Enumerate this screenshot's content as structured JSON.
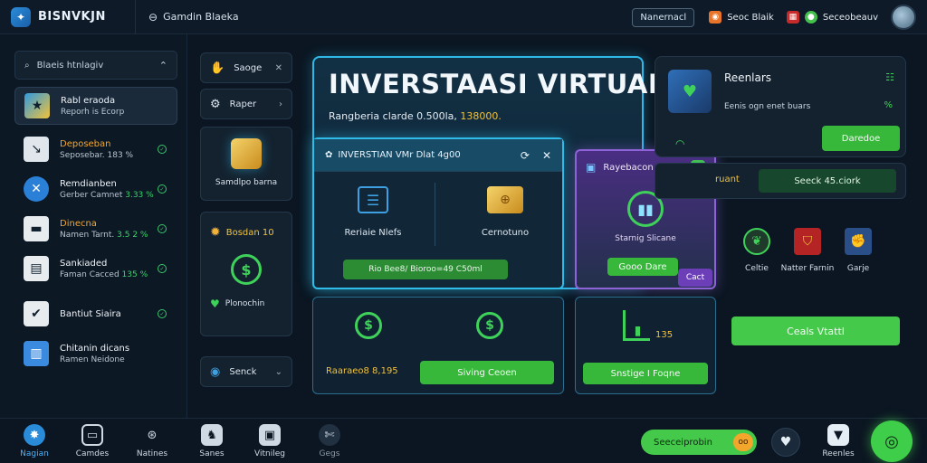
{
  "topbar": {
    "brand": "BISNVKJN",
    "search_label": "Gamdin Blaeka",
    "action_button": "Nanernacl",
    "items": [
      {
        "label": "Seoc Blaik",
        "color": "#e8742a"
      },
      {
        "label": "Seceobeauv",
        "color": "#44c04c"
      }
    ]
  },
  "sidebar": {
    "search_placeholder": "Blaeis htnlagiv",
    "items": [
      {
        "title": "Rabl eraoda",
        "sub": "Reporh is Ecorp",
        "color": "#f2c23a",
        "active": true
      },
      {
        "title": "Deposeban",
        "sub": "Seposebar. 183 %",
        "color": "#e0e6ec",
        "orange": true
      },
      {
        "title": "Remdianben",
        "sub": "Gerber Camnet",
        "sub_pct": "3.33 %",
        "color": "#2a7fd6"
      },
      {
        "title": "Dinecna",
        "sub": "Namen Tarnt.",
        "sub_pct": "3.5 2 %",
        "color": "#e8ecef",
        "orange": true
      },
      {
        "title": "Sankiaded",
        "sub": "Faman Cacced",
        "sub_pct": "135 %",
        "color": "#e8ecef"
      },
      {
        "title": "Bantiut Siaira",
        "sub": "",
        "color": "#e8ecef"
      },
      {
        "title": "Chitanin dicans",
        "sub": "Ramen Neidone",
        "color": "#3a8be0"
      }
    ]
  },
  "col2": {
    "btn1": "Saoge",
    "btn2": "Raper",
    "card1_label": "Samdlpo barna",
    "card2_title": "Bosdan 10",
    "card2_label": "Plonochin",
    "btn3": "Senck"
  },
  "hero": {
    "title": "INVERSTAASI VIRTUAL",
    "sub_prefix": "Rangberia clarde 0.500la,",
    "sub_value": "138000."
  },
  "modal": {
    "title": "INVERSTIAN VMr Dlat 4g00",
    "left_label": "Reriaie Nlefs",
    "right_label": "Cernotuno",
    "bar_label": "Rio Bee8/ Bioroo=49 C50ml"
  },
  "purple": {
    "title": "Rayebacon",
    "label": "Starnig Slicane",
    "button": "Gooo Dare",
    "badge": "Cact"
  },
  "lower": {
    "left_label": "Raaraeo8 8,195",
    "left_button": "Siving Ceoen",
    "right_value": "135",
    "right_button": "Snstige I Foqne"
  },
  "right_panel": {
    "title": "Reenlars",
    "sub": "Eenis ogn enet buars",
    "pct": "%",
    "button": "Daredoe",
    "row_left": "ruant",
    "row_right": "Seeck 45.ciork",
    "icons": [
      {
        "label": "Celtie"
      },
      {
        "label": "Natter Farnin"
      },
      {
        "label": "Garje"
      }
    ],
    "big_button": "Ceals Vtattl"
  },
  "bottombar": {
    "items": [
      {
        "label": "Nagian",
        "active": true
      },
      {
        "label": "Camdes"
      },
      {
        "label": "Natines"
      },
      {
        "label": "Sanes"
      },
      {
        "label": "Vitnileg"
      },
      {
        "label": "Gegs"
      }
    ],
    "cta": "Seeceiprobin",
    "cta_badge": "oo",
    "right_label": "Reenles"
  }
}
